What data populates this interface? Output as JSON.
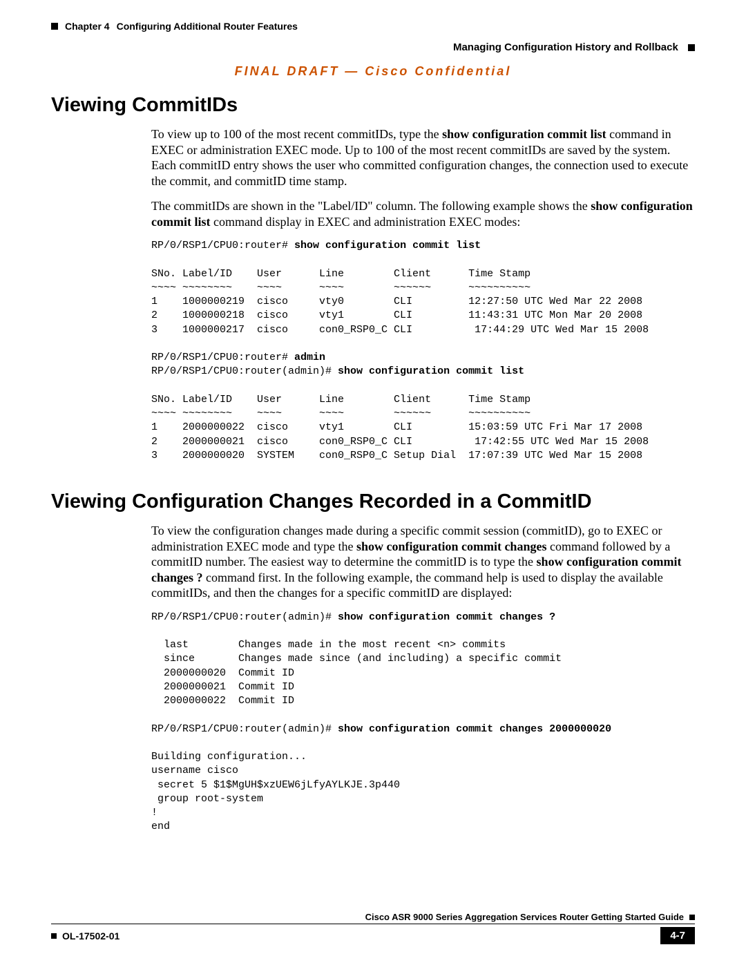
{
  "header": {
    "chapter": "Chapter 4",
    "chapter_title": "Configuring Additional Router Features",
    "section": "Managing Configuration History and Rollback"
  },
  "banner": "FINAL DRAFT — Cisco Confidential",
  "sec1": {
    "heading": "Viewing CommitIDs",
    "p1a": "To view up to 100 of the most recent commitIDs, type the ",
    "p1b": "show configuration commit list",
    "p1c": " command in EXEC or administration EXEC mode. Up to 100 of the most recent commitIDs are saved by the system. Each commitID entry shows the user who committed configuration changes, the connection used to execute the commit, and commitID time stamp.",
    "p2a": "The commitIDs are shown in the \"Label/ID\" column. The following example shows the ",
    "p2b": "show configuration commit list",
    "p2c": " command display in EXEC and administration EXEC modes:",
    "code1": {
      "prompt1": "RP/0/RSP1/CPU0:router# ",
      "cmd1": "show configuration commit list",
      "table": "\nSNo. Label/ID    User      Line        Client      Time Stamp\n~~~~ ~~~~~~~~    ~~~~      ~~~~        ~~~~~~      ~~~~~~~~~~\n1    1000000219  cisco     vty0        CLI         12:27:50 UTC Wed Mar 22 2008\n2    1000000218  cisco     vty1        CLI         11:43:31 UTC Mon Mar 20 2008\n3    1000000217  cisco     con0_RSP0_C CLI          17:44:29 UTC Wed Mar 15 2008\n",
      "prompt2": "RP/0/RSP1/CPU0:router# ",
      "cmd2": "admin",
      "prompt3": "\nRP/0/RSP1/CPU0:router(admin)# ",
      "cmd3": "show configuration commit list",
      "table2": "\nSNo. Label/ID    User      Line        Client      Time Stamp\n~~~~ ~~~~~~~~    ~~~~      ~~~~        ~~~~~~      ~~~~~~~~~~\n1    2000000022  cisco     vty1        CLI         15:03:59 UTC Fri Mar 17 2008\n2    2000000021  cisco     con0_RSP0_C CLI          17:42:55 UTC Wed Mar 15 2008\n3    2000000020  SYSTEM    con0_RSP0_C Setup Dial  17:07:39 UTC Wed Mar 15 2008"
    }
  },
  "sec2": {
    "heading": "Viewing Configuration Changes Recorded in a CommitID",
    "p1a": "To view the configuration changes made during a specific commit session (commitID), go to EXEC or administration EXEC mode and type the ",
    "p1b": "show configuration commit changes",
    "p1c": " command followed by a commitID number. The easiest way to determine the commitID is to type the ",
    "p1d": "show configuration commit changes ?",
    "p1e": " command first. In the following example, the command help is used to display the available commitIDs, and then the changes for a specific commitID are displayed:",
    "code2": {
      "prompt1": "RP/0/RSP1/CPU0:router(admin)# ",
      "cmd1": "show configuration commit changes ?",
      "block1": "\n  last        Changes made in the most recent <n> commits\n  since       Changes made since (and including) a specific commit\n  2000000020  Commit ID\n  2000000021  Commit ID\n  2000000022  Commit ID\n",
      "prompt2": "RP/0/RSP1/CPU0:router(admin)# ",
      "cmd2": "show configuration commit changes 2000000020",
      "block2": "\nBuilding configuration...\nusername cisco\n secret 5 $1$MgUH$xzUEW6jLfyAYLKJE.3p440\n group root-system\n!\nend"
    }
  },
  "footer": {
    "guide": "Cisco ASR 9000 Series Aggregation Services Router Getting Started Guide",
    "docnum": "OL-17502-01",
    "pagenum": "4-7"
  }
}
